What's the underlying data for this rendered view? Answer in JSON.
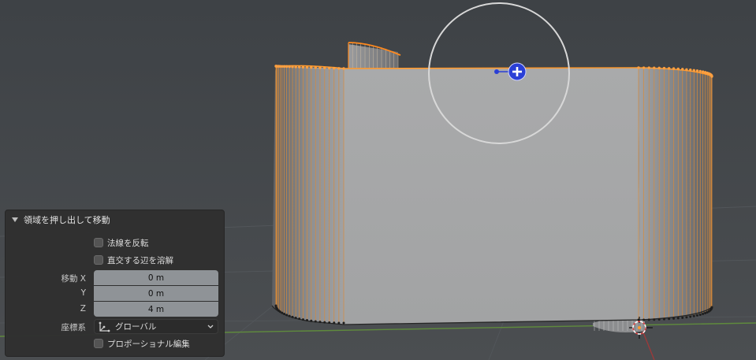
{
  "panel": {
    "title": "領域を押し出して移動",
    "flip_normals_label": "法線を反転",
    "dissolve_orthogonal_label": "直交する辺を溶解",
    "move_label": "移動",
    "x_axis_label": "X",
    "y_axis_label": "Y",
    "z_axis_label": "Z",
    "move_x_value": "0 m",
    "move_y_value": "0 m",
    "move_z_value": "4 m",
    "orientation_label": "座標系",
    "orientation_value": "グローバル",
    "proportional_editing_label": "プロポーショナル編集",
    "flip_normals_checked": false,
    "dissolve_orthogonal_checked": false,
    "proportional_editing_checked": false
  },
  "viewport": {
    "background_color": "#404448",
    "mesh_face_color": "#a6a7a8",
    "selection_color": "#ff8a1f",
    "gizmo_color": "#2a3fd6",
    "icons": [
      "transform-gizmo-icon",
      "3d-cursor-icon",
      "orientation-axes-icon",
      "chevron-down-icon"
    ]
  }
}
